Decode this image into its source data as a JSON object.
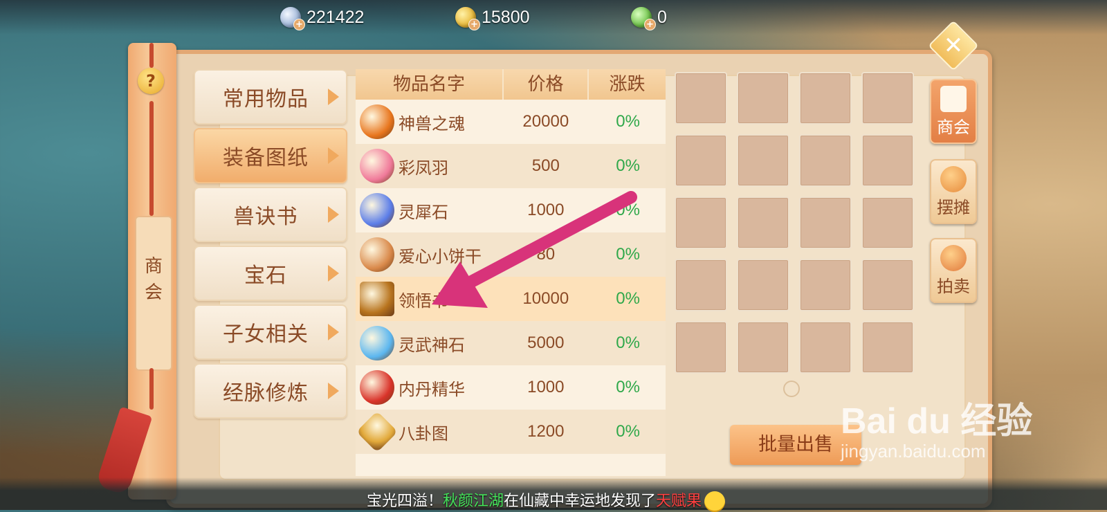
{
  "currency": [
    {
      "icon": "silver-coin-icon",
      "value": "221422"
    },
    {
      "icon": "gold-coin-icon",
      "value": "15800"
    },
    {
      "icon": "jade-coin-icon",
      "value": "0"
    }
  ],
  "banner": {
    "help": "?",
    "title_line1": "商",
    "title_line2": "会"
  },
  "categories": [
    {
      "label": "常用物品"
    },
    {
      "label": "装备图纸"
    },
    {
      "label": "兽诀书"
    },
    {
      "label": "宝石"
    },
    {
      "label": "子女相关"
    },
    {
      "label": "经脉修炼"
    }
  ],
  "table": {
    "headers": {
      "name": "物品名字",
      "price": "价格",
      "change": "涨跌"
    },
    "rows": [
      {
        "name": "神兽之魂",
        "price": "20000",
        "change": "0%",
        "icon_color": "#e8761e"
      },
      {
        "name": "彩凤羽",
        "price": "500",
        "change": "0%",
        "icon_color": "#f07a9a"
      },
      {
        "name": "灵犀石",
        "price": "1000",
        "change": "0%",
        "icon_color": "#5b7de8"
      },
      {
        "name": "爱心小饼干",
        "price": "80",
        "change": "0%",
        "icon_color": "#d9894a"
      },
      {
        "name": "领悟书",
        "price": "10000",
        "change": "0%",
        "icon_color": "#b8741e"
      },
      {
        "name": "灵武神石",
        "price": "5000",
        "change": "0%",
        "icon_color": "#5bb6ef"
      },
      {
        "name": "内丹精华",
        "price": "1000",
        "change": "0%",
        "icon_color": "#d9332a"
      },
      {
        "name": "八卦图",
        "price": "1200",
        "change": "0%",
        "icon_color": "#e2a93a"
      }
    ]
  },
  "bulk_sell": "批量出售",
  "side_tabs": [
    {
      "label": "商会",
      "icon": "guild-icon"
    },
    {
      "label": "摆摊",
      "icon": "stall-icon"
    },
    {
      "label": "拍卖",
      "icon": "auction-icon"
    }
  ],
  "close": "✕",
  "broadcast": {
    "p1": "宝光四溢！",
    "player": "秋颜江湖",
    "p2": "在仙藏中幸运地发现了",
    "item": "天赋果"
  },
  "watermark": {
    "brand": "Bai du 经验",
    "url": "jingyan.baidu.com"
  },
  "colors": {
    "accent": "#f1ad6c",
    "change_color": "#2fa84a",
    "arrow": "#d8337a"
  }
}
